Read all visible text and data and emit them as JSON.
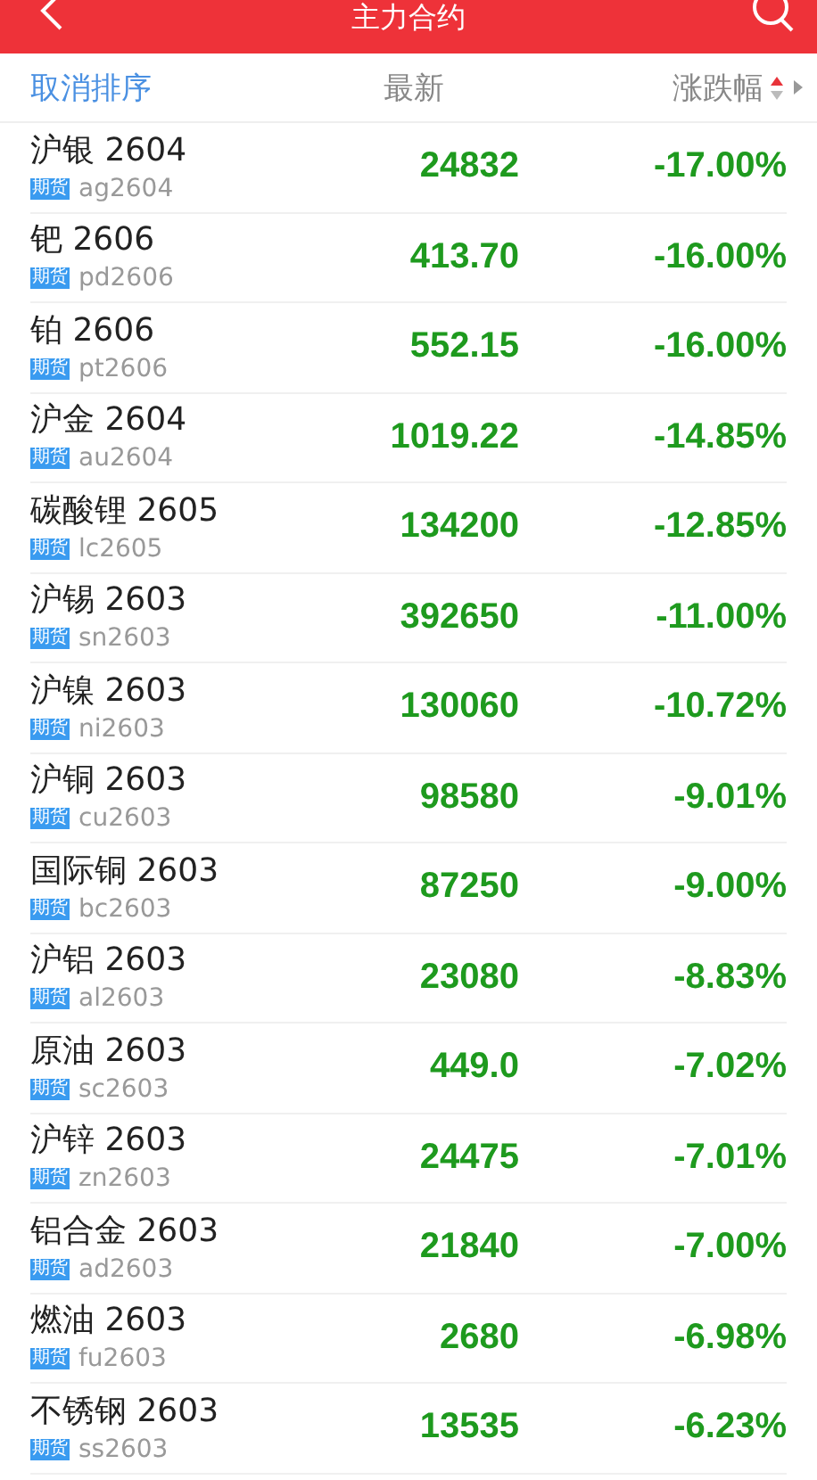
{
  "title_bar": {
    "title": "主力合约"
  },
  "header": {
    "cancel_sort": "取消排序",
    "columns": [
      {
        "label": "最新",
        "sorted": false
      },
      {
        "label": "涨跌幅",
        "sorted": true
      }
    ]
  },
  "rows": [
    {
      "name": "沪银 2604",
      "tag": "期货",
      "code": "ag2604",
      "price": "24832",
      "change": "-17.00%"
    },
    {
      "name": "钯 2606",
      "tag": "期货",
      "code": "pd2606",
      "price": "413.70",
      "change": "-16.00%"
    },
    {
      "name": "铂 2606",
      "tag": "期货",
      "code": "pt2606",
      "price": "552.15",
      "change": "-16.00%"
    },
    {
      "name": "沪金 2604",
      "tag": "期货",
      "code": "au2604",
      "price": "1019.22",
      "change": "-14.85%"
    },
    {
      "name": "碳酸锂 2605",
      "tag": "期货",
      "code": "lc2605",
      "price": "134200",
      "change": "-12.85%"
    },
    {
      "name": "沪锡 2603",
      "tag": "期货",
      "code": "sn2603",
      "price": "392650",
      "change": "-11.00%"
    },
    {
      "name": "沪镍 2603",
      "tag": "期货",
      "code": "ni2603",
      "price": "130060",
      "change": "-10.72%"
    },
    {
      "name": "沪铜 2603",
      "tag": "期货",
      "code": "cu2603",
      "price": "98580",
      "change": "-9.01%"
    },
    {
      "name": "国际铜 2603",
      "tag": "期货",
      "code": "bc2603",
      "price": "87250",
      "change": "-9.00%"
    },
    {
      "name": "沪铝 2603",
      "tag": "期货",
      "code": "al2603",
      "price": "23080",
      "change": "-8.83%"
    },
    {
      "name": "原油 2603",
      "tag": "期货",
      "code": "sc2603",
      "price": "449.0",
      "change": "-7.02%"
    },
    {
      "name": "沪锌 2603",
      "tag": "期货",
      "code": "zn2603",
      "price": "24475",
      "change": "-7.01%"
    },
    {
      "name": "铝合金 2603",
      "tag": "期货",
      "code": "ad2603",
      "price": "21840",
      "change": "-7.00%"
    },
    {
      "name": "燃油 2603",
      "tag": "期货",
      "code": "fu2603",
      "price": "2680",
      "change": "-6.98%"
    },
    {
      "name": "不锈钢 2603",
      "tag": "期货",
      "code": "ss2603",
      "price": "13535",
      "change": "-6.23%"
    }
  ]
}
